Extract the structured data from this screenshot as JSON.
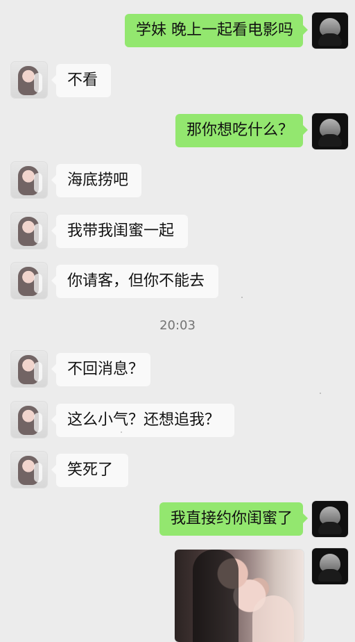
{
  "messages": [
    {
      "side": "right",
      "text": "学妹 晚上一起看电影吗"
    },
    {
      "side": "left",
      "text": "不看"
    },
    {
      "side": "right",
      "text": "那你想吃什么？"
    },
    {
      "side": "left",
      "text": "海底捞吧"
    },
    {
      "side": "left",
      "text": "我带我闺蜜一起"
    },
    {
      "side": "left",
      "text": "你请客，但你不能去"
    },
    {
      "side": "left",
      "text": "不回消息？"
    },
    {
      "side": "left",
      "text": "这么小气？还想追我？"
    },
    {
      "side": "left",
      "text": "笑死了"
    },
    {
      "side": "right",
      "text": "我直接约你闺蜜了"
    }
  ],
  "timestamp": "20:03",
  "image_message": {
    "type": "photo"
  },
  "colors": {
    "background": "#ececec",
    "left_bubble": "#f9f9f9",
    "right_bubble": "#93e76f",
    "timestamp": "#747474"
  },
  "icons": {
    "female_avatar": "female-avatar-icon",
    "male_avatar": "male-avatar-icon"
  }
}
